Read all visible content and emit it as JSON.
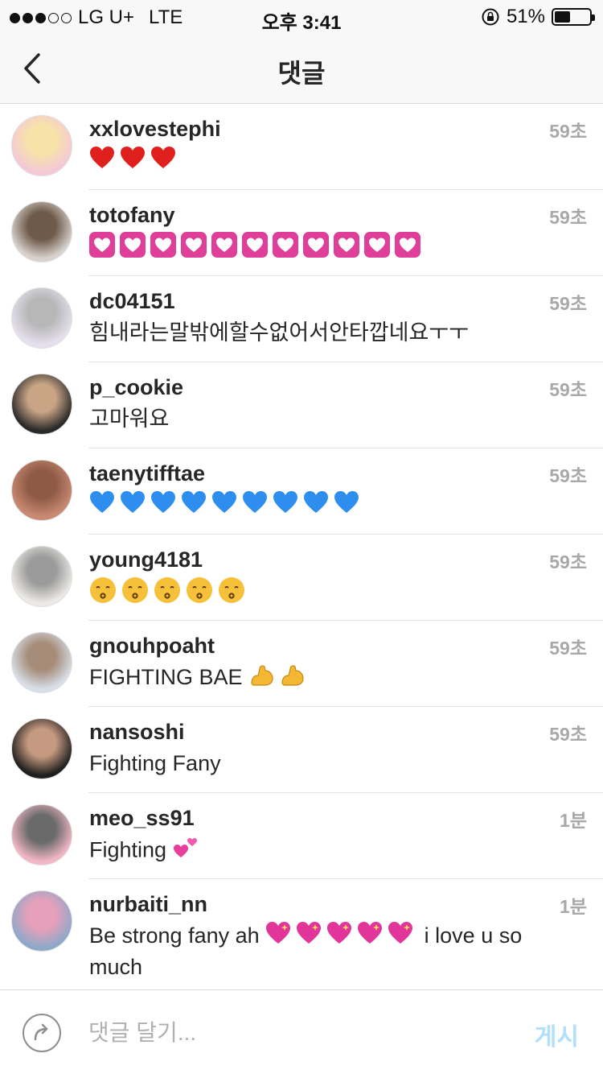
{
  "status_bar": {
    "carrier": "LG U+",
    "network": "LTE",
    "time": "오후 3:41",
    "battery": "51%",
    "battery_level": 0.51,
    "signal_bars_filled": 3
  },
  "header": {
    "title": "댓글",
    "back_icon": "chevron-left-icon"
  },
  "comments": [
    {
      "username": "xxlovestephi",
      "time": "59초",
      "content": "",
      "emoji": {
        "kind": "heart-red",
        "count": 3
      }
    },
    {
      "username": "totofany",
      "time": "59초",
      "content": "",
      "emoji": {
        "kind": "heart-pink",
        "count": 11
      }
    },
    {
      "username": "dc04151",
      "time": "59초",
      "content": "힘내라는말밖에할수없어서안타깝네요ㅜㅜ"
    },
    {
      "username": "p_cookie",
      "time": "59초",
      "content": "고마워요"
    },
    {
      "username": "taenytifftae",
      "time": "59초",
      "content": "",
      "emoji": {
        "kind": "heart-blue",
        "count": 9
      }
    },
    {
      "username": "young4181",
      "time": "59초",
      "content": "",
      "emoji": {
        "kind": "kiss",
        "count": 5
      }
    },
    {
      "username": "gnouhpoaht",
      "time": "59초",
      "content": "FIGHTING BAE",
      "emoji": {
        "kind": "muscle",
        "count": 2
      }
    },
    {
      "username": "nansoshi",
      "time": "59초",
      "content": "Fighting Fany"
    },
    {
      "username": "meo_ss91",
      "time": "1분",
      "content": "Fighting",
      "emoji": {
        "kind": "two-hearts",
        "count": 1
      }
    },
    {
      "username": "nurbaiti_nn",
      "time": "1분",
      "content": "Be strong fany ah",
      "emoji": {
        "kind": "sparkle-heart",
        "count": 5
      },
      "content_after": "i love u so much"
    }
  ],
  "composer": {
    "placeholder": "댓글 달기...",
    "post_label": "게시",
    "share_icon": "share-arrow-icon"
  },
  "colors": {
    "post_button": "#b2dffc",
    "muted_text": "#a8a8a8",
    "text": "#262626"
  }
}
